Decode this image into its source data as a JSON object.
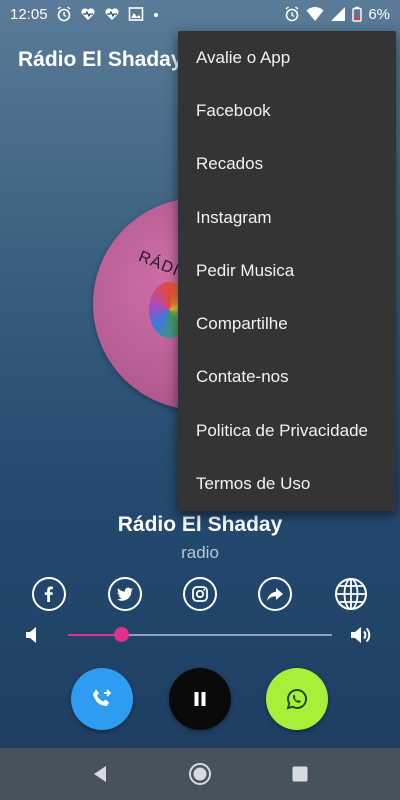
{
  "status_bar": {
    "time": "12:05",
    "left_icons": [
      "alarm-icon",
      "heart-monitor-icon",
      "heart-monitor-icon",
      "image-icon",
      "dot-icon"
    ],
    "battery_percent": "6%",
    "right_icons": [
      "alarm-icon",
      "wifi-icon",
      "signal-icon",
      "battery-low-icon"
    ]
  },
  "toolbar": {
    "title": "Rádio El Shaday"
  },
  "album": {
    "art_text": "RÁDIO"
  },
  "station": {
    "name": "Rádio El Shaday",
    "genre": "radio"
  },
  "social": [
    {
      "name": "facebook",
      "icon": "facebook-icon"
    },
    {
      "name": "twitter",
      "icon": "twitter-icon"
    },
    {
      "name": "instagram",
      "icon": "instagram-icon"
    },
    {
      "name": "share",
      "icon": "share-arrow-icon"
    },
    {
      "name": "website",
      "icon": "globe-icon"
    }
  ],
  "volume": {
    "level": 0.2,
    "accent": "#e0328c"
  },
  "controls": {
    "call_color": "#2e9cf0",
    "pause_color": "#0a0a0a",
    "whatsapp_color": "#a6f03a"
  },
  "menu": {
    "items": [
      "Avalie o App",
      "Facebook",
      "Recados",
      "Instagram",
      "Pedir Musica",
      "Compartilhe",
      "Contate-nos",
      "Politica de Privacidade",
      "Termos de Uso"
    ]
  }
}
